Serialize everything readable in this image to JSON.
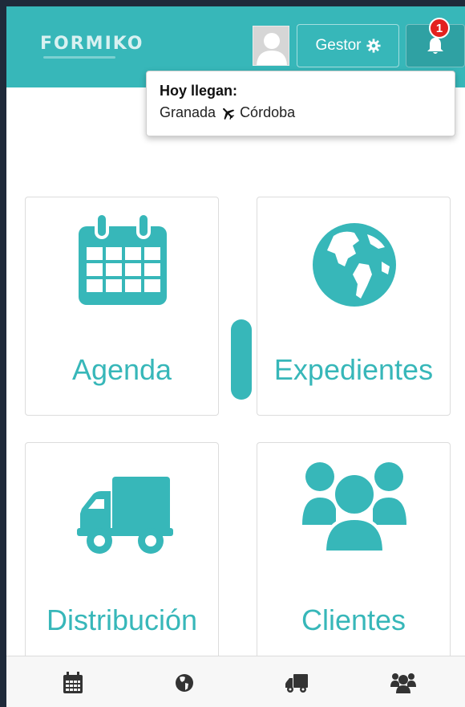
{
  "header": {
    "logo_text": "FORMIKO",
    "gestor_label": "Gestor",
    "notification_count": "1"
  },
  "notification_popover": {
    "title": "Hoy llegan:",
    "origin": "Granada",
    "destination": "Córdoba"
  },
  "tiles": [
    {
      "label": "Agenda",
      "icon": "calendar-icon"
    },
    {
      "label": "Expedientes",
      "icon": "globe-icon"
    },
    {
      "label": "Distribución",
      "icon": "truck-icon"
    },
    {
      "label": "Clientes",
      "icon": "users-icon"
    }
  ],
  "bottom_nav": [
    "calendar-icon",
    "globe-icon",
    "truck-icon",
    "users-icon"
  ],
  "colors": {
    "accent": "#37b7b9",
    "badge": "#e3211e",
    "nav_icon": "#333333"
  }
}
